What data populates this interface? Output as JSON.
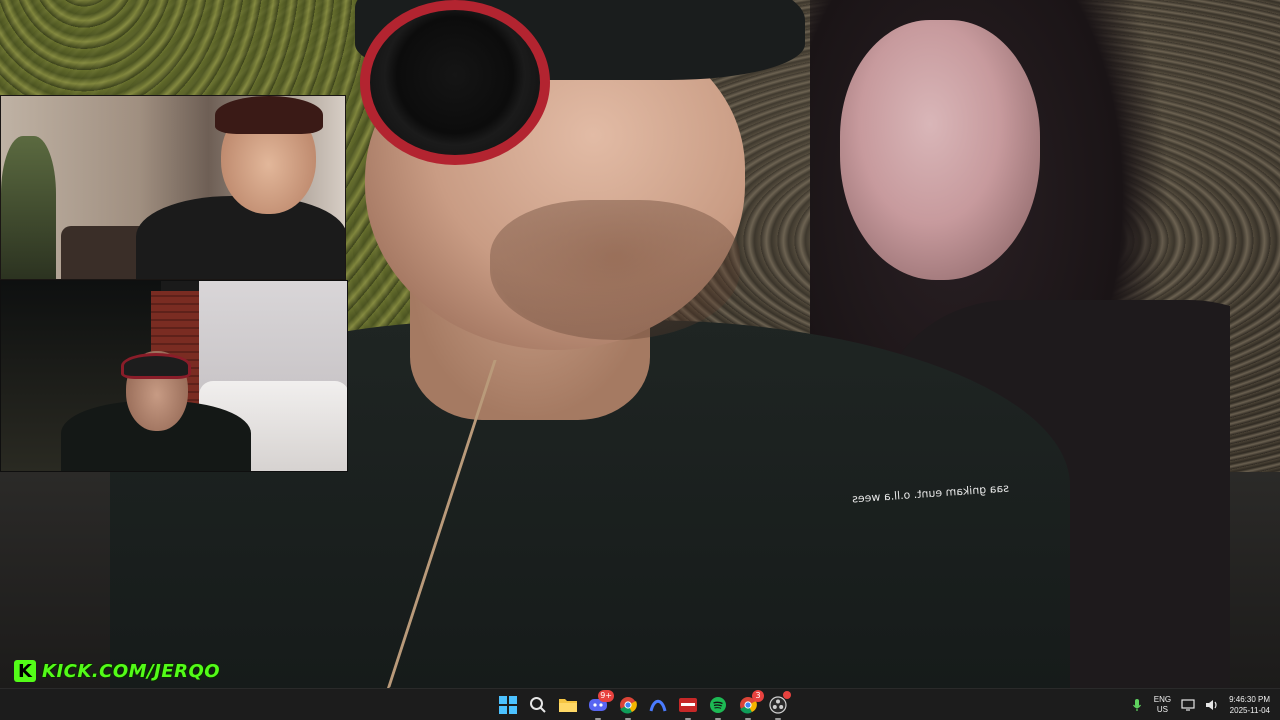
{
  "stream": {
    "branding": {
      "logo_letter": "K",
      "url": "KICK.COM/JERQO",
      "color": "#53fc18"
    },
    "overlay_caption": "saa gnikam eunt. o.ll.a wees"
  },
  "taskbar": {
    "apps": [
      {
        "name": "start",
        "icon": "windows-logo-icon"
      },
      {
        "name": "search",
        "icon": "search-icon"
      },
      {
        "name": "file-explorer",
        "icon": "folder-icon"
      },
      {
        "name": "discord",
        "icon": "discord-icon",
        "badge": "9+"
      },
      {
        "name": "chrome",
        "icon": "chrome-icon"
      },
      {
        "name": "arc",
        "icon": "arc-browser-icon"
      },
      {
        "name": "streaming-app",
        "icon": "stream-deck-icon"
      },
      {
        "name": "spotify",
        "icon": "spotify-icon"
      },
      {
        "name": "chrome-profile",
        "icon": "chrome-profile-icon",
        "badge": "3"
      },
      {
        "name": "obs",
        "icon": "obs-icon",
        "badge_dot": true
      }
    ],
    "tray": {
      "lang_line1": "ENG",
      "lang_line2": "US",
      "time": "9:46:30 PM",
      "date": "2025-11-04"
    }
  }
}
